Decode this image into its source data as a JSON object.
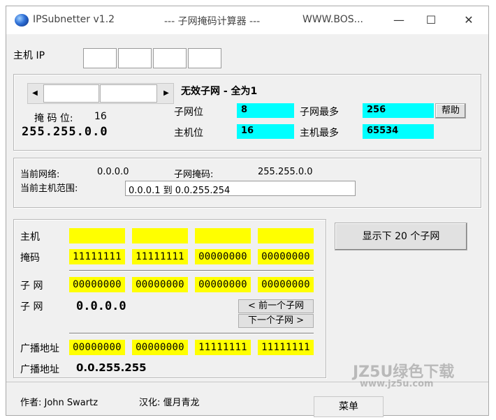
{
  "window": {
    "app_title": "IPSubnetter v1.2",
    "subtitle": "--- 子网掩码计算器 ---",
    "website": "WWW.BOS...",
    "minimize_glyph": "—",
    "maximize_glyph": "☐",
    "close_glyph": "✕"
  },
  "host_ip": {
    "label": "主机 IP",
    "octets": [
      "",
      "",
      "",
      ""
    ]
  },
  "mask_panel": {
    "scroll_left": "◀",
    "scroll_right": "▶",
    "mask_bits_label": "掩 码 位:",
    "mask_bits_value": "16",
    "mask_value": "255.255.0.0",
    "invalid_subnet_text": "无效子网 - 全为1",
    "subnet_bits_label": "子网位",
    "subnet_bits_value": "8",
    "subnet_max_label": "子网最多",
    "subnet_max_value": "256",
    "host_bits_label": "主机位",
    "host_bits_value": "16",
    "host_max_label": "主机最多",
    "host_max_value": "65534",
    "help_button": "帮助"
  },
  "current_network": {
    "network_label": "当前网络:",
    "network_value": "0.0.0.0",
    "subnet_mask_label": "子网掩码:",
    "subnet_mask_value": "255.255.0.0",
    "host_range_label": "当前主机范围:",
    "host_range_value": "0.0.0.1  到  0.0.255.254"
  },
  "binary_panel": {
    "host_label": "主机",
    "host_bits": [
      "",
      "",
      "",
      ""
    ],
    "mask_label": "掩码",
    "mask_bits": [
      "11111111",
      "11111111",
      "00000000",
      "00000000"
    ],
    "subnet_label": "子 网",
    "subnet_bits": [
      "00000000",
      "00000000",
      "00000000",
      "00000000"
    ],
    "subnet_label2": "子 网",
    "subnet_value": "0.0.0.0",
    "prev_subnet_button": "< 前一个子网",
    "next_subnet_button": "下一个子网 >",
    "broadcast_label": "广播地址",
    "broadcast_bits": [
      "00000000",
      "00000000",
      "11111111",
      "11111111"
    ],
    "broadcast_label2": "广播地址",
    "broadcast_value": "0.0.255.255"
  },
  "show_next_button": "显示下 20 个子网",
  "footer": {
    "author": "作者: John Swartz",
    "translator": "汉化: 偃月青龙",
    "menu_button": "菜单"
  },
  "watermark": {
    "line1": "JZ5U绿色下载",
    "line2": "www.jz5u.com"
  },
  "colors": {
    "cyan_field": "#00ffff",
    "yellow_field": "#ffff00",
    "window_bg": "#f0f0f0"
  }
}
